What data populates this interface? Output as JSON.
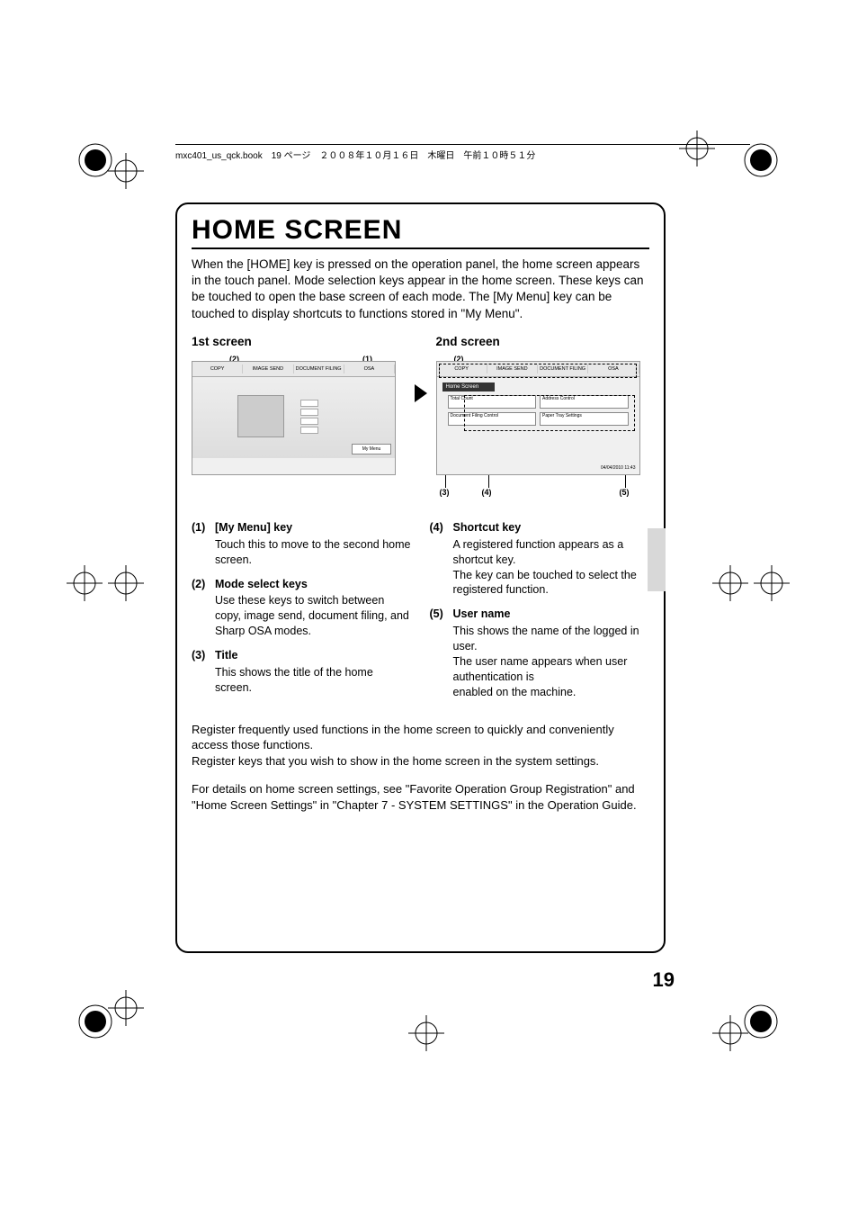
{
  "header": "mxc401_us_qck.book　19 ページ　２００８年１０月１６日　木曜日　午前１０時５１分",
  "title": "HOME SCREEN",
  "intro": "When the [HOME] key is pressed on the operation panel, the home screen appears in the touch panel. Mode selection keys appear in the home screen. These keys can be touched to open the base screen of each mode. The [My Menu] key can be touched to display shortcuts to functions stored in \"My Menu\".",
  "screen1_label": "1st screen",
  "screen2_label": "2nd screen",
  "callouts": {
    "c1": "(1)",
    "c2": "(2)",
    "c3": "(3)",
    "c4": "(4)",
    "c5": "(5)"
  },
  "tabs": {
    "copy": "COPY",
    "image_send": "IMAGE SEND",
    "doc_filing": "DOCUMENT FILING",
    "osa": "OSA"
  },
  "mymenu": "My Menu",
  "screen2": {
    "title_bar": "Home Screen",
    "s1": "Total Count",
    "s2": "Address Control",
    "s3": "Document Filing Control",
    "s4": "Paper Tray Settings",
    "timestamp": "04/04/2010 11:43"
  },
  "desc_left": [
    {
      "num": "(1)",
      "title": "[My Menu] key",
      "body": "Touch this to move to the second home screen."
    },
    {
      "num": "(2)",
      "title": "Mode select keys",
      "body": "Use these keys to switch between copy, image send, document filing, and Sharp OSA modes."
    },
    {
      "num": "(3)",
      "title": "Title",
      "body": "This shows the title of the home screen."
    }
  ],
  "desc_right": [
    {
      "num": "(4)",
      "title": "Shortcut key",
      "body": "A registered function appears as a shortcut key.\nThe key can be touched to select the registered function."
    },
    {
      "num": "(5)",
      "title": "User name",
      "body": "This shows the name of the logged in user.\nThe user name appears when user authentication is\nenabled on the machine."
    }
  ],
  "bottom1": "Register frequently used functions in the home screen to quickly and conveniently access those functions.\nRegister keys that you wish to show in the home screen in the system settings.",
  "bottom2": "For details on home screen settings, see \"Favorite Operation Group Registration\" and \"Home Screen Settings\" in \"Chapter 7 - SYSTEM SETTINGS\" in the Operation Guide.",
  "page_number": "19"
}
